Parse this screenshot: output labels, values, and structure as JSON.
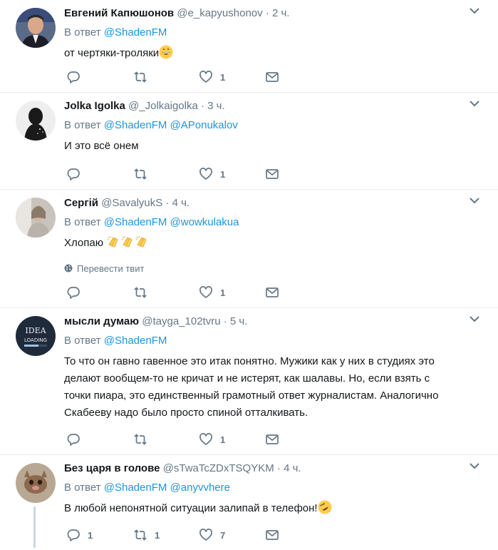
{
  "tweets": [
    {
      "name": "Евгений Капюшонов",
      "handle": "@e_kapyushonov",
      "time": "2 ч.",
      "reply_label": "В ответ",
      "mentions": [
        "@ShadenFM"
      ],
      "text": "от чертяки-троляки",
      "emoji": "grinning-face",
      "reply_count": "",
      "retweet_count": "",
      "like_count": "1"
    },
    {
      "name": "Jolka Igolka",
      "handle": "@_Jolkaigolka",
      "time": "3 ч.",
      "reply_label": "В ответ",
      "mentions": [
        "@ShadenFM",
        "@APonukalov"
      ],
      "text": "И это всё онем",
      "reply_count": "",
      "retweet_count": "",
      "like_count": "1"
    },
    {
      "name": "Сергій",
      "handle": "@SavalyukS",
      "time": "4 ч.",
      "reply_label": "В ответ",
      "mentions": [
        "@ShadenFM",
        "@wowkulakua"
      ],
      "text": "Хлопаю",
      "emoji": "clapping-hands",
      "translate_label": "Перевести твит",
      "reply_count": "",
      "retweet_count": "",
      "like_count": "1"
    },
    {
      "name": "мысли думаю",
      "handle": "@tayga_102tvru",
      "time": "5 ч.",
      "reply_label": "В ответ",
      "mentions": [
        "@ShadenFM"
      ],
      "text_lines": [
        "То что он гавно гавенное это итак понятно. Мужики как у них в студиях это",
        "делают вообщем-то не кричат и не истерят, как шалавы. Но, если взять с",
        "точки пиара, это единственный грамотный ответ журналистам. Аналогично",
        "Скабееву надо было просто спиной отталкивать."
      ],
      "avatar_text": [
        "IDEA",
        "LOADING"
      ],
      "reply_count": "",
      "retweet_count": "",
      "like_count": "1"
    },
    {
      "name": "Без царя в голове",
      "handle": "@sTwaTcZDxTSQYKM",
      "time": "4 ч.",
      "reply_label": "В ответ",
      "mentions": [
        "@ShadenFM",
        "@anyvvhere"
      ],
      "text": "В любой непонятной ситуации залипай в телефон!",
      "emoji": "rolling-laughing-face",
      "reply_count": "1",
      "retweet_count": "1",
      "like_count": "7"
    }
  ],
  "colors": {
    "text": "#14171a",
    "secondary": "#657786",
    "link": "#1b95e0",
    "border": "#e6ecf0"
  }
}
